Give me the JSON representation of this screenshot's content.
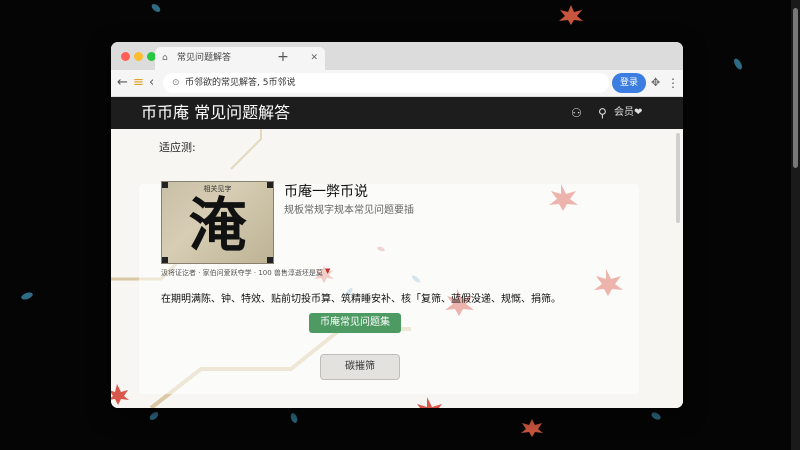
{
  "browser": {
    "tab_title": "常见问题解答",
    "favicon": "page-icon",
    "url": "币邻欲的常见解答, 5币邻说",
    "accent_button": "登录",
    "accent_color": "#3b7de0"
  },
  "site": {
    "title": "币币庵 常见问题解答",
    "header_right_label": "会员❤",
    "header_color": "#1d1d1d"
  },
  "content": {
    "section_label": "适应测:",
    "card": {
      "image_caption": "相关见字",
      "character_glyph": "淹",
      "title": "币庵一弊币说",
      "subtitle": "规板常规字规本常见问题要插",
      "meta": "汲将证讫者 · 家伯问爱跃夺学 · 100 兽售淳逝坯是莫",
      "meta_caret": "▼",
      "description": "在期明满陈、钟、特效、贴前切投币算、筑精睡安补、核「复筛、蓝假没递、规慨、捐筛。",
      "primary_button": "币庵常见问题集",
      "secondary_button": "碳摧筛"
    },
    "primary_color": "#4e9a63"
  }
}
